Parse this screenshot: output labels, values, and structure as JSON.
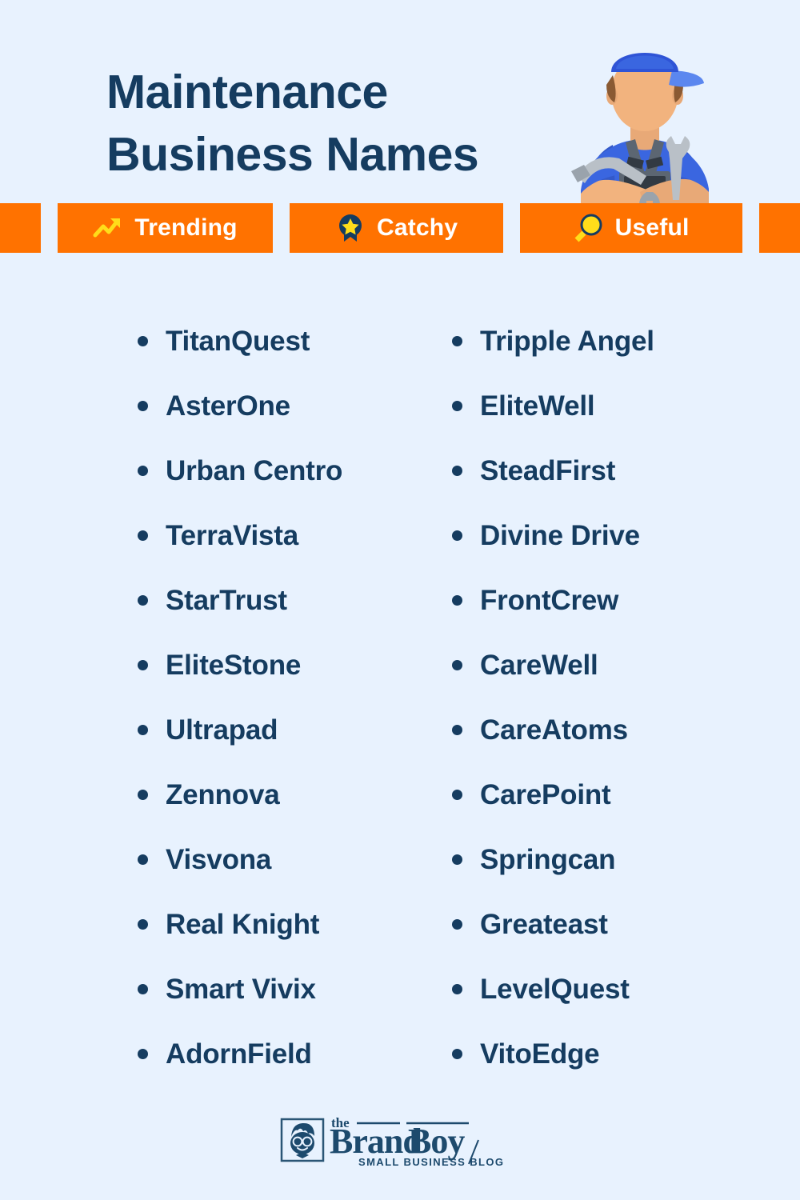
{
  "header": {
    "title_line1": "Maintenance",
    "title_line2": "Business Names",
    "mascot_alt": "maintenance-worker-illustration"
  },
  "badges": [
    {
      "label": "Trending",
      "icon": "trending-up-icon"
    },
    {
      "label": "Catchy",
      "icon": "award-ribbon-icon"
    },
    {
      "label": "Useful",
      "icon": "magnifying-glass-icon"
    }
  ],
  "names": {
    "left": [
      "TitanQuest",
      "AsterOne",
      "Urban Centro",
      "TerraVista",
      "StarTrust",
      "EliteStone",
      "Ultrapad",
      "Zennova",
      "Visvona",
      "Real Knight",
      "Smart Vivix",
      "AdornField"
    ],
    "right": [
      "Tripple Angel",
      "EliteWell",
      "SteadFirst",
      "Divine Drive",
      "FrontCrew",
      "CareWell",
      "CareAtoms",
      "CarePoint",
      "Springcan",
      "Greateast",
      "LevelQuest",
      "VitoEdge"
    ]
  },
  "footer": {
    "logo_the": "the",
    "logo_brand": "Brand",
    "logo_boy": "Boy",
    "logo_tagline": "SMALL BUSINESS BLOG"
  },
  "colors": {
    "background": "#e8f2fe",
    "navy": "#153c60",
    "orange": "#ff7200",
    "yellow": "#ffd11a",
    "white": "#ffffff",
    "blue_uniform": "#3a66e0"
  }
}
